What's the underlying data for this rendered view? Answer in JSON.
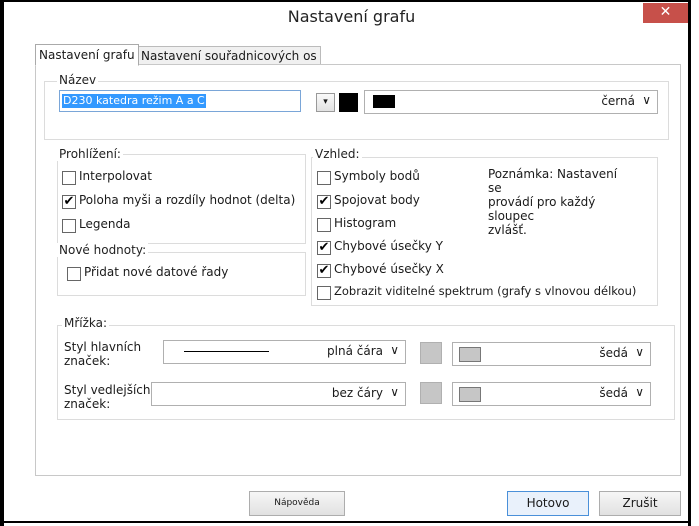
{
  "window": {
    "title": "Nastavení grafu",
    "close_glyph": "✕"
  },
  "tabs": [
    {
      "label": "Nastavení grafu",
      "active": true
    },
    {
      "label": "Nastavení souřadnicových os",
      "active": false
    }
  ],
  "name_group": {
    "title": "Název",
    "value": "D230 katedra režim A a C",
    "dropdown_glyph": "▾",
    "color": {
      "label": "černá",
      "hex": "#000000",
      "chevron": "∨"
    }
  },
  "browse_group": {
    "title": "Prohlížení:",
    "items": [
      {
        "label": "Interpolovat",
        "checked": false
      },
      {
        "label": "Poloha myši a rozdíly hodnot (delta)",
        "checked": true
      },
      {
        "label": "Legenda",
        "checked": false
      }
    ]
  },
  "new_values_group": {
    "title": "Nové hodnoty:",
    "items": [
      {
        "label": "Přidat nové datové řady",
        "checked": false
      }
    ]
  },
  "appearance_group": {
    "title": "Vzhled:",
    "items": [
      {
        "label": "Symboly bodů",
        "checked": false
      },
      {
        "label": "Spojovat body",
        "checked": true
      },
      {
        "label": "Histogram",
        "checked": false
      },
      {
        "label": "Chybové úsečky Y",
        "checked": true
      },
      {
        "label": "Chybové úsečky X",
        "checked": true
      },
      {
        "label": "Zobrazit viditelné spektrum (grafy s vlnovou délkou)",
        "checked": false
      }
    ],
    "note_lines": [
      "Poznámka: Nastavení se",
      "provádí pro každý sloupec",
      "zvlášť."
    ]
  },
  "grid_group": {
    "title": "Mřížka:",
    "major": {
      "label_lines": [
        "Styl hlavních",
        "značek:"
      ],
      "style": "plná čára",
      "color": {
        "label": "šedá",
        "hex": "#c6c6c6"
      },
      "chevron": "∨"
    },
    "minor": {
      "label_lines": [
        "Styl vedlejších",
        "značek:"
      ],
      "style": "bez čáry",
      "color": {
        "label": "šedá",
        "hex": "#c6c6c6"
      },
      "chevron": "∨"
    }
  },
  "buttons": {
    "help": "Nápověda",
    "ok": "Hotovo",
    "cancel": "Zrušit"
  },
  "check_glyph": "✔"
}
